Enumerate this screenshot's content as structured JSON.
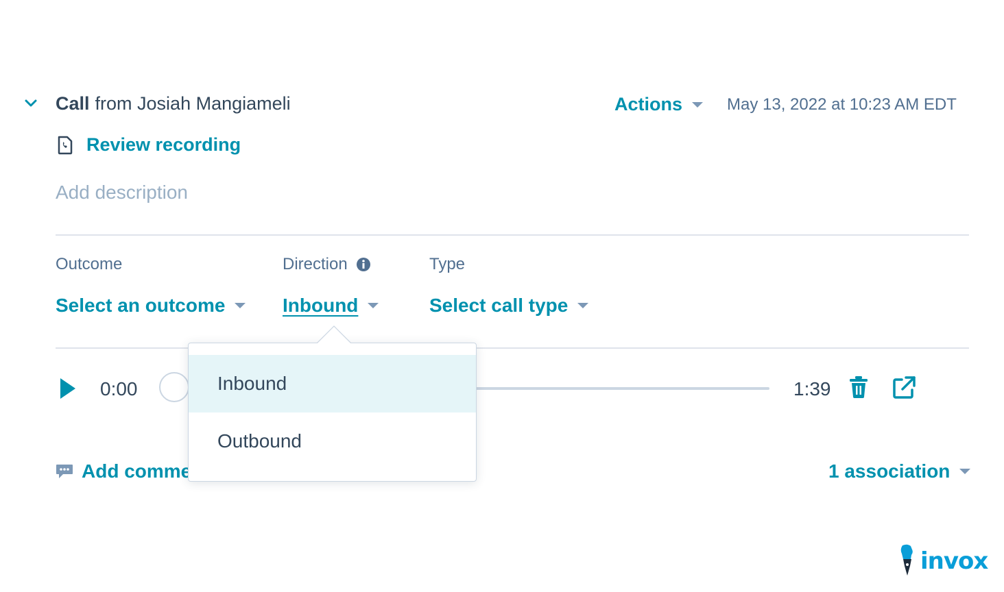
{
  "header": {
    "title_bold": "Call",
    "title_rest": "from Josiah Mangiameli",
    "actions_label": "Actions",
    "timestamp": "May 13, 2022 at 10:23 AM EDT"
  },
  "review": {
    "label": "Review recording"
  },
  "description": {
    "placeholder": "Add description"
  },
  "fields": {
    "outcome": {
      "label": "Outcome",
      "value": "Select an outcome"
    },
    "direction": {
      "label": "Direction",
      "value": "Inbound"
    },
    "type": {
      "label": "Type",
      "value": "Select call type"
    }
  },
  "player": {
    "current_time": "0:00",
    "duration": "1:39",
    "progress": 0
  },
  "footer": {
    "comment_label": "Add comment",
    "association_label": "1 association"
  },
  "direction_dropdown": {
    "options": [
      "Inbound",
      "Outbound"
    ],
    "selected": "Inbound"
  },
  "watermark": {
    "text": "invox"
  },
  "colors": {
    "accent": "#0091ae",
    "text": "#33475b",
    "muted": "#516f90",
    "placeholder": "#99afc4",
    "divider": "#dfe3eb",
    "selected_bg": "#e5f5f8"
  }
}
